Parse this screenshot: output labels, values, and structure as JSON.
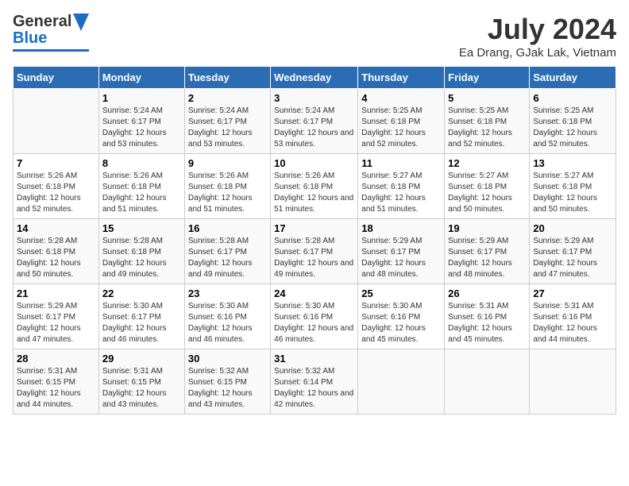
{
  "logo": {
    "general": "General",
    "blue": "Blue"
  },
  "header": {
    "month_year": "July 2024",
    "location": "Ea Drang, GJak Lak, Vietnam"
  },
  "columns": [
    "Sunday",
    "Monday",
    "Tuesday",
    "Wednesday",
    "Thursday",
    "Friday",
    "Saturday"
  ],
  "weeks": [
    [
      {
        "day": "",
        "sunrise": "",
        "sunset": "",
        "daylight": ""
      },
      {
        "day": "1",
        "sunrise": "Sunrise: 5:24 AM",
        "sunset": "Sunset: 6:17 PM",
        "daylight": "Daylight: 12 hours and 53 minutes."
      },
      {
        "day": "2",
        "sunrise": "Sunrise: 5:24 AM",
        "sunset": "Sunset: 6:17 PM",
        "daylight": "Daylight: 12 hours and 53 minutes."
      },
      {
        "day": "3",
        "sunrise": "Sunrise: 5:24 AM",
        "sunset": "Sunset: 6:17 PM",
        "daylight": "Daylight: 12 hours and 53 minutes."
      },
      {
        "day": "4",
        "sunrise": "Sunrise: 5:25 AM",
        "sunset": "Sunset: 6:18 PM",
        "daylight": "Daylight: 12 hours and 52 minutes."
      },
      {
        "day": "5",
        "sunrise": "Sunrise: 5:25 AM",
        "sunset": "Sunset: 6:18 PM",
        "daylight": "Daylight: 12 hours and 52 minutes."
      },
      {
        "day": "6",
        "sunrise": "Sunrise: 5:25 AM",
        "sunset": "Sunset: 6:18 PM",
        "daylight": "Daylight: 12 hours and 52 minutes."
      }
    ],
    [
      {
        "day": "7",
        "sunrise": "Sunrise: 5:26 AM",
        "sunset": "Sunset: 6:18 PM",
        "daylight": "Daylight: 12 hours and 52 minutes."
      },
      {
        "day": "8",
        "sunrise": "Sunrise: 5:26 AM",
        "sunset": "Sunset: 6:18 PM",
        "daylight": "Daylight: 12 hours and 51 minutes."
      },
      {
        "day": "9",
        "sunrise": "Sunrise: 5:26 AM",
        "sunset": "Sunset: 6:18 PM",
        "daylight": "Daylight: 12 hours and 51 minutes."
      },
      {
        "day": "10",
        "sunrise": "Sunrise: 5:26 AM",
        "sunset": "Sunset: 6:18 PM",
        "daylight": "Daylight: 12 hours and 51 minutes."
      },
      {
        "day": "11",
        "sunrise": "Sunrise: 5:27 AM",
        "sunset": "Sunset: 6:18 PM",
        "daylight": "Daylight: 12 hours and 51 minutes."
      },
      {
        "day": "12",
        "sunrise": "Sunrise: 5:27 AM",
        "sunset": "Sunset: 6:18 PM",
        "daylight": "Daylight: 12 hours and 50 minutes."
      },
      {
        "day": "13",
        "sunrise": "Sunrise: 5:27 AM",
        "sunset": "Sunset: 6:18 PM",
        "daylight": "Daylight: 12 hours and 50 minutes."
      }
    ],
    [
      {
        "day": "14",
        "sunrise": "Sunrise: 5:28 AM",
        "sunset": "Sunset: 6:18 PM",
        "daylight": "Daylight: 12 hours and 50 minutes."
      },
      {
        "day": "15",
        "sunrise": "Sunrise: 5:28 AM",
        "sunset": "Sunset: 6:18 PM",
        "daylight": "Daylight: 12 hours and 49 minutes."
      },
      {
        "day": "16",
        "sunrise": "Sunrise: 5:28 AM",
        "sunset": "Sunset: 6:17 PM",
        "daylight": "Daylight: 12 hours and 49 minutes."
      },
      {
        "day": "17",
        "sunrise": "Sunrise: 5:28 AM",
        "sunset": "Sunset: 6:17 PM",
        "daylight": "Daylight: 12 hours and 49 minutes."
      },
      {
        "day": "18",
        "sunrise": "Sunrise: 5:29 AM",
        "sunset": "Sunset: 6:17 PM",
        "daylight": "Daylight: 12 hours and 48 minutes."
      },
      {
        "day": "19",
        "sunrise": "Sunrise: 5:29 AM",
        "sunset": "Sunset: 6:17 PM",
        "daylight": "Daylight: 12 hours and 48 minutes."
      },
      {
        "day": "20",
        "sunrise": "Sunrise: 5:29 AM",
        "sunset": "Sunset: 6:17 PM",
        "daylight": "Daylight: 12 hours and 47 minutes."
      }
    ],
    [
      {
        "day": "21",
        "sunrise": "Sunrise: 5:29 AM",
        "sunset": "Sunset: 6:17 PM",
        "daylight": "Daylight: 12 hours and 47 minutes."
      },
      {
        "day": "22",
        "sunrise": "Sunrise: 5:30 AM",
        "sunset": "Sunset: 6:17 PM",
        "daylight": "Daylight: 12 hours and 46 minutes."
      },
      {
        "day": "23",
        "sunrise": "Sunrise: 5:30 AM",
        "sunset": "Sunset: 6:16 PM",
        "daylight": "Daylight: 12 hours and 46 minutes."
      },
      {
        "day": "24",
        "sunrise": "Sunrise: 5:30 AM",
        "sunset": "Sunset: 6:16 PM",
        "daylight": "Daylight: 12 hours and 46 minutes."
      },
      {
        "day": "25",
        "sunrise": "Sunrise: 5:30 AM",
        "sunset": "Sunset: 6:16 PM",
        "daylight": "Daylight: 12 hours and 45 minutes."
      },
      {
        "day": "26",
        "sunrise": "Sunrise: 5:31 AM",
        "sunset": "Sunset: 6:16 PM",
        "daylight": "Daylight: 12 hours and 45 minutes."
      },
      {
        "day": "27",
        "sunrise": "Sunrise: 5:31 AM",
        "sunset": "Sunset: 6:16 PM",
        "daylight": "Daylight: 12 hours and 44 minutes."
      }
    ],
    [
      {
        "day": "28",
        "sunrise": "Sunrise: 5:31 AM",
        "sunset": "Sunset: 6:15 PM",
        "daylight": "Daylight: 12 hours and 44 minutes."
      },
      {
        "day": "29",
        "sunrise": "Sunrise: 5:31 AM",
        "sunset": "Sunset: 6:15 PM",
        "daylight": "Daylight: 12 hours and 43 minutes."
      },
      {
        "day": "30",
        "sunrise": "Sunrise: 5:32 AM",
        "sunset": "Sunset: 6:15 PM",
        "daylight": "Daylight: 12 hours and 43 minutes."
      },
      {
        "day": "31",
        "sunrise": "Sunrise: 5:32 AM",
        "sunset": "Sunset: 6:14 PM",
        "daylight": "Daylight: 12 hours and 42 minutes."
      },
      {
        "day": "",
        "sunrise": "",
        "sunset": "",
        "daylight": ""
      },
      {
        "day": "",
        "sunrise": "",
        "sunset": "",
        "daylight": ""
      },
      {
        "day": "",
        "sunrise": "",
        "sunset": "",
        "daylight": ""
      }
    ]
  ]
}
